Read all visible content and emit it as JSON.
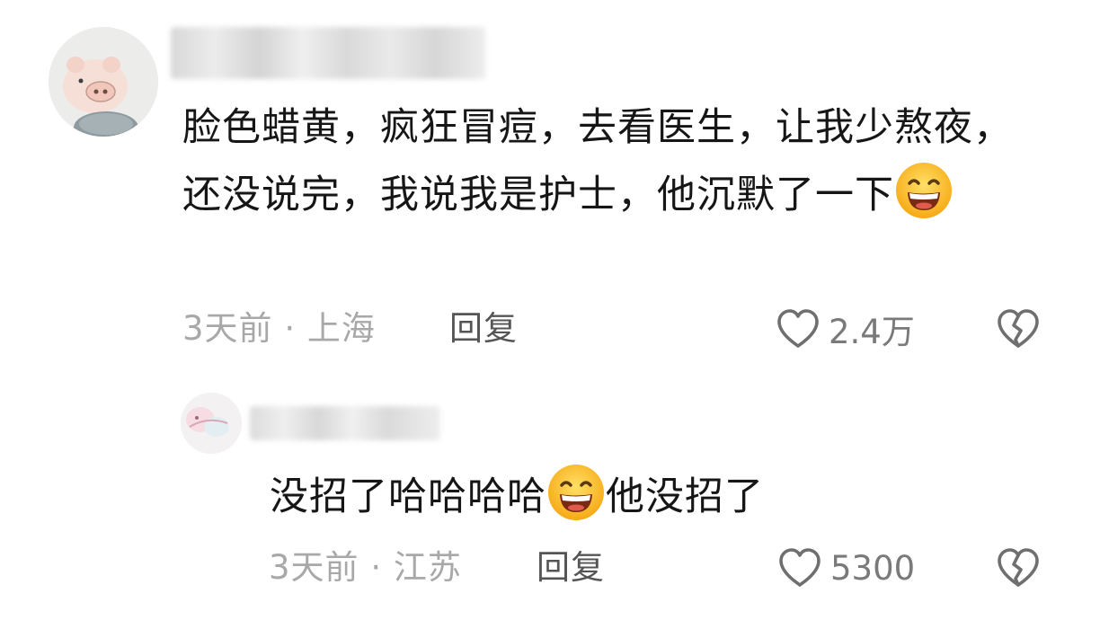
{
  "comments": [
    {
      "text_before_emoji": "脸色蜡黄，疯狂冒痘，去看医生，让我少熬夜，还没说完，我说我是护士，他沉默了一下",
      "text_after_emoji": "",
      "emoji_icon": "grinning-face-emoji",
      "time": "3天前",
      "separator": "·",
      "location": "上海",
      "reply_label": "回复",
      "like_count": "2.4万",
      "like_icon": "heart-outline-icon",
      "dislike_icon": "broken-heart-icon"
    },
    {
      "text_before_emoji": "没招了哈哈哈哈",
      "text_after_emoji": "他没招了",
      "emoji_icon": "grinning-face-emoji",
      "time": "3天前",
      "separator": "·",
      "location": "江苏",
      "reply_label": "回复",
      "like_count": "5300",
      "like_icon": "heart-outline-icon",
      "dislike_icon": "broken-heart-icon"
    }
  ],
  "colors": {
    "body_text": "#161616",
    "meta_text": "#a8a8a8",
    "reply_link": "#555555",
    "icon_stroke": "#6f6f6f",
    "emoji_face": "#ffcc33"
  }
}
